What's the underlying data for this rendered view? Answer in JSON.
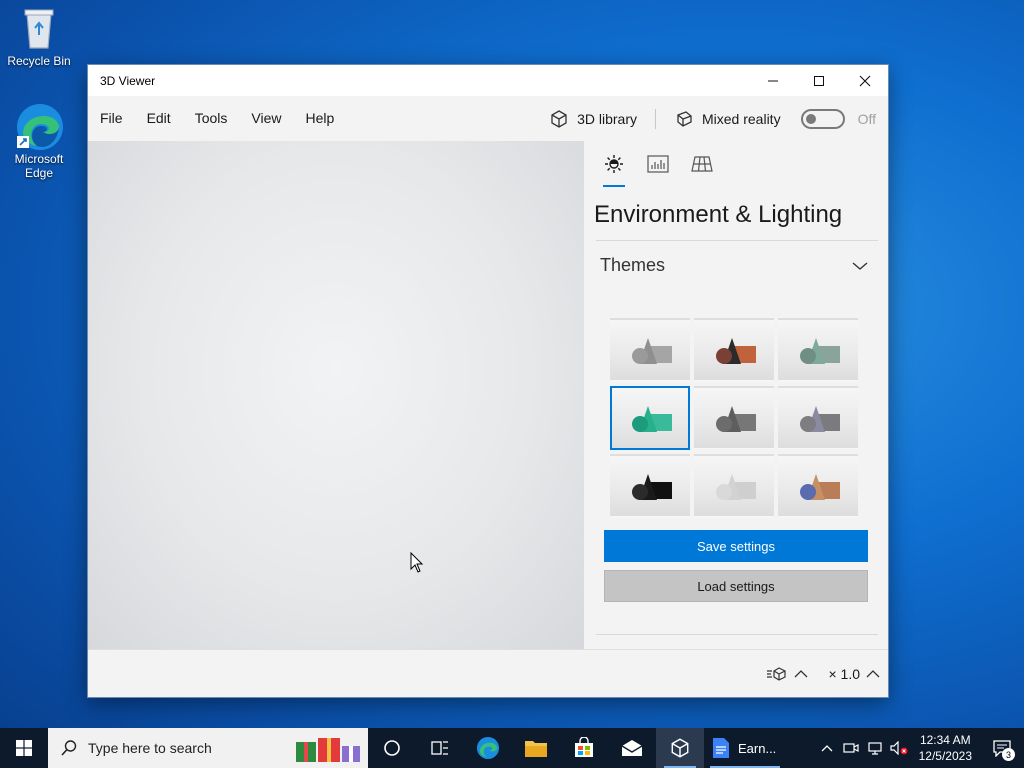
{
  "desktop": {
    "icons": [
      {
        "label": "Recycle Bin"
      },
      {
        "label": "Microsoft Edge"
      }
    ]
  },
  "window": {
    "title": "3D Viewer",
    "controls": {
      "minimize": "minimize-icon",
      "maximize": "maximize-icon",
      "close": "close-icon"
    },
    "menu": [
      "File",
      "Edit",
      "Tools",
      "View",
      "Help"
    ],
    "library_label": "3D library",
    "mixed_reality_label": "Mixed reality",
    "mixed_reality_state": "Off"
  },
  "panel": {
    "tabs": [
      "environment-lighting-icon",
      "stats-icon",
      "grid-icon"
    ],
    "active_tab": 0,
    "heading": "Environment & Lighting",
    "section_label": "Themes",
    "themes": [
      {
        "id": "theme-1",
        "colors": [
          "#9a9a9a",
          "#8f8f8f",
          "#a5a5a5"
        ],
        "selected": false
      },
      {
        "id": "theme-2",
        "colors": [
          "#7a3f35",
          "#2b2b2b",
          "#c0623c"
        ],
        "selected": false
      },
      {
        "id": "theme-3",
        "colors": [
          "#6f8f85",
          "#7fa99c",
          "#8aa39b"
        ],
        "selected": false
      },
      {
        "id": "theme-4",
        "colors": [
          "#1c9c7c",
          "#27b08c",
          "#3ab99b"
        ],
        "selected": true
      },
      {
        "id": "theme-5",
        "colors": [
          "#6c6c6c",
          "#5e5e5e",
          "#777777"
        ],
        "selected": false
      },
      {
        "id": "theme-6",
        "colors": [
          "#7d7d82",
          "#8a8aa0",
          "#7a7a7f"
        ],
        "selected": false
      },
      {
        "id": "theme-7",
        "colors": [
          "#2b2b2b",
          "#1a1a1a",
          "#111111"
        ],
        "selected": false
      },
      {
        "id": "theme-8",
        "colors": [
          "#d9d9d9",
          "#d2d2d2",
          "#cfcfcf"
        ],
        "selected": false
      },
      {
        "id": "theme-9",
        "colors": [
          "#5a6bb0",
          "#c79064",
          "#b97d58"
        ],
        "selected": false
      }
    ],
    "save_label": "Save settings",
    "load_label": "Load settings",
    "accent": "#0078d7"
  },
  "statusbar": {
    "scale_label": "× 1.0"
  },
  "taskbar": {
    "search_placeholder": "Type here to search",
    "doc_label": "Earn...",
    "time": "12:34 AM",
    "date": "12/5/2023",
    "notification_count": "3"
  }
}
